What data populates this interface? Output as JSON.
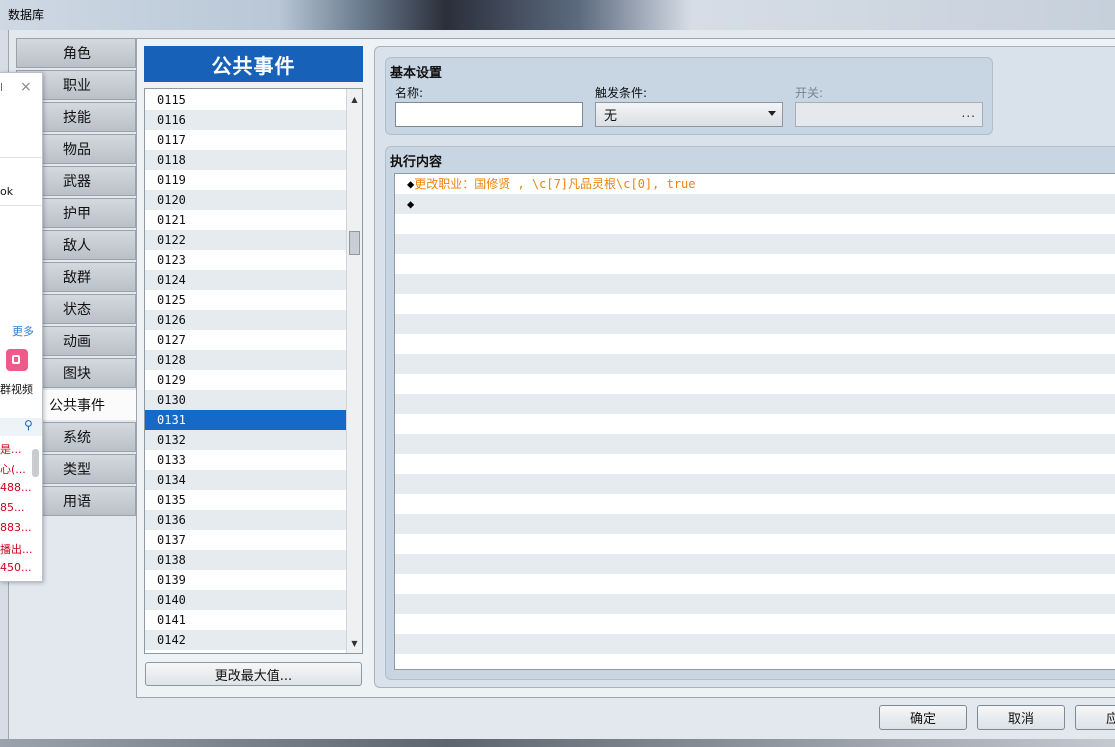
{
  "window": {
    "title": "数据库"
  },
  "tabs": [
    {
      "label": "角色"
    },
    {
      "label": "职业"
    },
    {
      "label": "技能"
    },
    {
      "label": "物品"
    },
    {
      "label": "武器"
    },
    {
      "label": "护甲"
    },
    {
      "label": "敌人"
    },
    {
      "label": "敌群"
    },
    {
      "label": "状态"
    },
    {
      "label": "动画"
    },
    {
      "label": "图块"
    },
    {
      "label": "公共事件",
      "active": true
    },
    {
      "label": "系统"
    },
    {
      "label": "类型"
    },
    {
      "label": "用语"
    }
  ],
  "list": {
    "header": "公共事件",
    "items": [
      "0115",
      "0116",
      "0117",
      "0118",
      "0119",
      "0120",
      "0121",
      "0122",
      "0123",
      "0124",
      "0125",
      "0126",
      "0127",
      "0128",
      "0129",
      "0130",
      "0131",
      "0132",
      "0133",
      "0134",
      "0135",
      "0136",
      "0137",
      "0138",
      "0139",
      "0140",
      "0141",
      "0142"
    ],
    "selected": "0131",
    "change_max_label": "更改最大值..."
  },
  "basic": {
    "title": "基本设置",
    "name_label": "名称:",
    "name_value": "",
    "trigger_label": "触发条件:",
    "trigger_value": "无",
    "switch_label": "开关:",
    "switch_ellipsis": "..."
  },
  "exec": {
    "title": "执行内容",
    "commands": [
      {
        "bullet": "◆",
        "text": "更改职业：国修贤 , \\c[7]凡品灵根\\c[0], true"
      },
      {
        "bullet": "◆",
        "text": ""
      }
    ]
  },
  "buttons": {
    "ok": "确定",
    "cancel": "取消",
    "apply": "应"
  },
  "popup": {
    "close": "×",
    "partial_top": "l",
    "partial_ok": "ok",
    "more": "更多",
    "video": "群视频",
    "results": [
      "是...",
      "心(...",
      "488...",
      "85...",
      "883...",
      "播出...",
      "450..."
    ]
  },
  "colors": {
    "selection": "#1569c7",
    "list_header": "#1761b8",
    "command_text": "#e8850c",
    "popup_link": "#2d7fd2",
    "popup_red": "#d0021b"
  }
}
